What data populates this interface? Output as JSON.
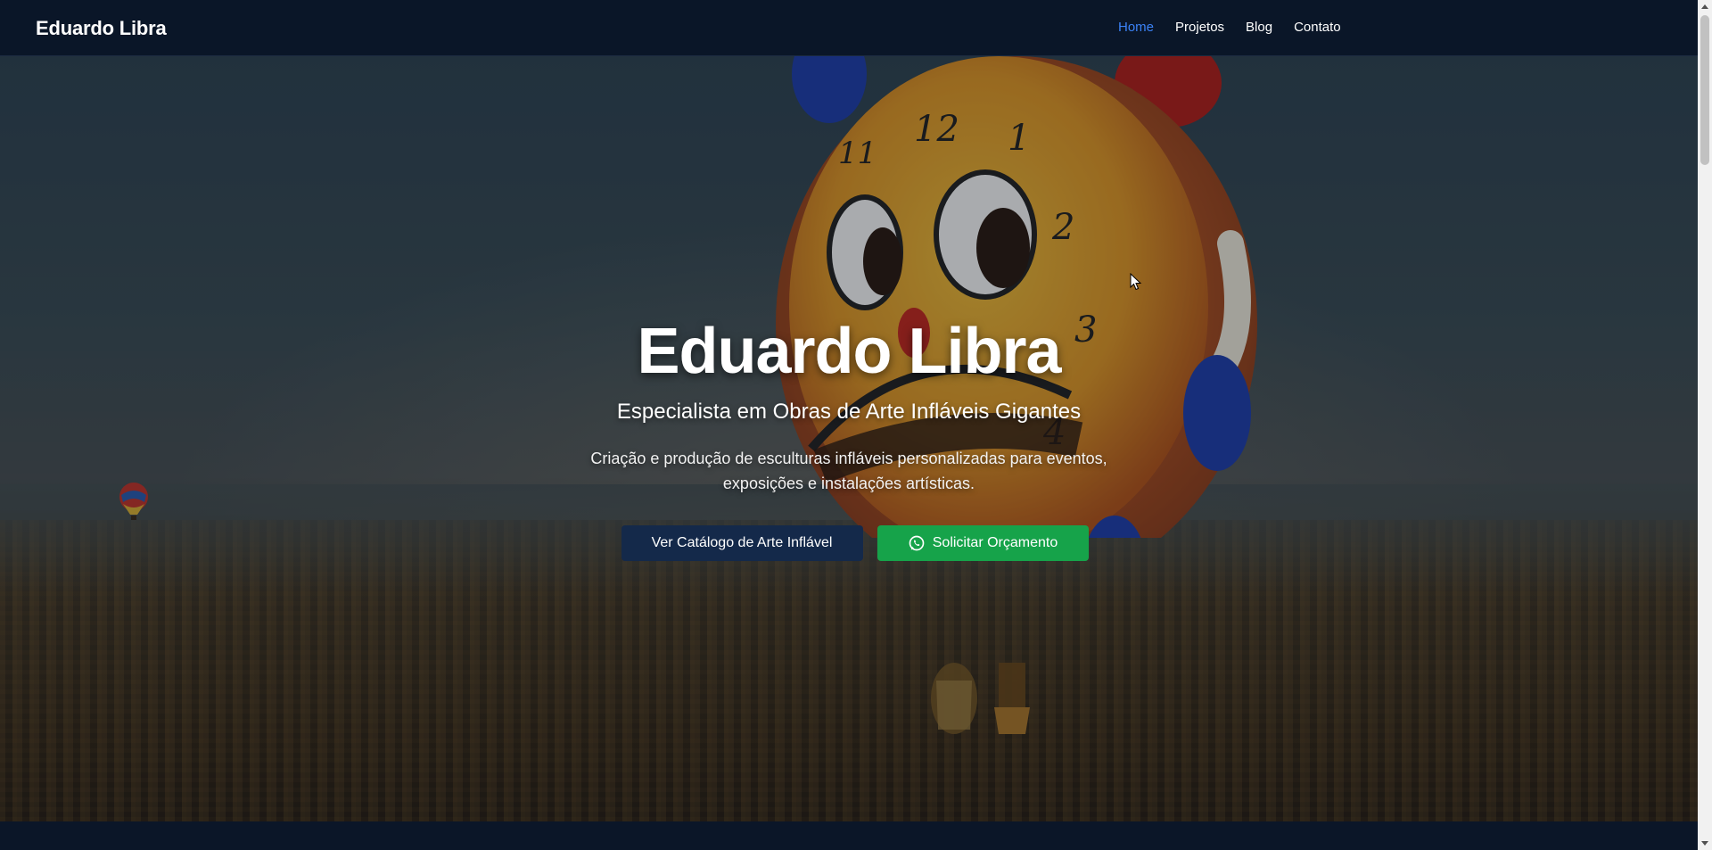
{
  "navbar": {
    "brand": "Eduardo Libra",
    "links": [
      {
        "label": "Home",
        "active": true
      },
      {
        "label": "Projetos",
        "active": false
      },
      {
        "label": "Blog",
        "active": false
      },
      {
        "label": "Contato",
        "active": false
      }
    ]
  },
  "hero": {
    "title": "Eduardo Libra",
    "subtitle": "Especialista em Obras de Arte Infláveis Gigantes",
    "description": "Criação e produção de esculturas infláveis personalizadas para eventos, exposições e instalações artísticas.",
    "buttons": {
      "catalog": "Ver Catálogo de Arte Inflável",
      "quote": "Solicitar Orçamento",
      "quote_icon": "whatsapp-icon"
    }
  },
  "colors": {
    "nav_bg": "#0a1628",
    "nav_active": "#3b82f6",
    "btn_catalog": "#14294a",
    "btn_quote": "#16a34a"
  }
}
